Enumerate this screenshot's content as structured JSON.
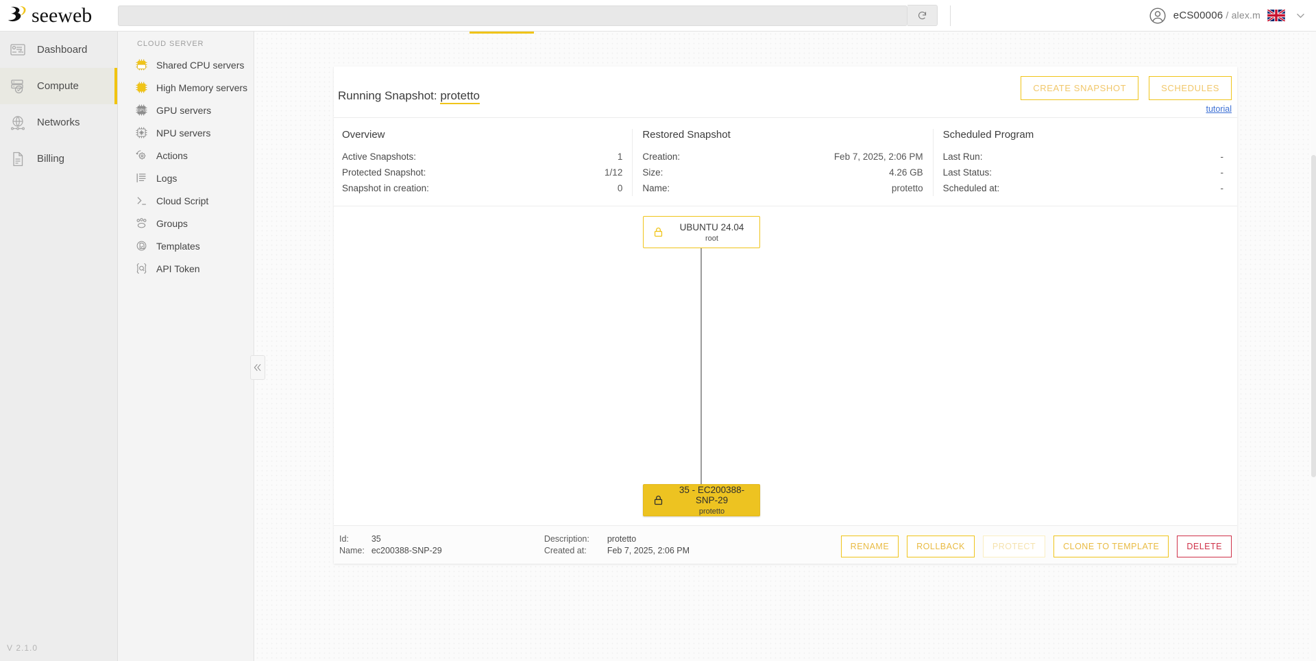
{
  "topbar": {
    "logo_text": "seeweb",
    "search": {
      "value": "",
      "placeholder": ""
    },
    "refresh_icon": "refresh-icon",
    "avatar_icon": "user-avatar-icon",
    "account": "eCS00006",
    "account_separator": " / ",
    "username": "alex.m",
    "flag_icon": "uk-flag-icon",
    "chevron_icon": "chevron-down-icon"
  },
  "sidebar": {
    "items": [
      {
        "label": "Dashboard",
        "icon": "dashboard-icon",
        "active": false
      },
      {
        "label": "Compute",
        "icon": "server-icon",
        "active": true
      },
      {
        "label": "Networks",
        "icon": "globe-network-icon",
        "active": false
      },
      {
        "label": "Billing",
        "icon": "document-icon",
        "active": false
      }
    ],
    "version": "V 2.1.0"
  },
  "subsidebar": {
    "title": "CLOUD SERVER",
    "items": [
      {
        "label": "Shared CPU servers",
        "icon": "cpu-chip-icon"
      },
      {
        "label": "High Memory servers",
        "icon": "memory-chip-icon"
      },
      {
        "label": "GPU servers",
        "icon": "gpu-chip-icon"
      },
      {
        "label": "NPU servers",
        "icon": "npu-chip-icon"
      },
      {
        "label": "Actions",
        "icon": "gear-actions-icon"
      },
      {
        "label": "Logs",
        "icon": "list-logs-icon"
      },
      {
        "label": "Cloud Script",
        "icon": "terminal-prompt-icon"
      },
      {
        "label": "Groups",
        "icon": "groups-people-icon"
      },
      {
        "label": "Templates",
        "icon": "templates-icon"
      },
      {
        "label": "API Token",
        "icon": "api-token-icon"
      }
    ],
    "collapse_icon": "double-chevron-left-icon"
  },
  "main": {
    "title_prefix": "Running Snapshot: ",
    "title_value": "protetto",
    "create_snapshot_label": "CREATE SNAPSHOT",
    "schedules_label": "SCHEDULES",
    "tutorial_label": "tutorial",
    "info": {
      "overview": {
        "heading": "Overview",
        "rows": [
          {
            "key": "Active Snapshots:",
            "value": "1"
          },
          {
            "key": "Protected Snapshot:",
            "value": "1/12"
          },
          {
            "key": "Snapshot in creation:",
            "value": "0"
          }
        ]
      },
      "restored": {
        "heading": "Restored Snapshot",
        "rows": [
          {
            "key": "Creation:",
            "value": "Feb 7, 2025, 2:06 PM"
          },
          {
            "key": "Size:",
            "value": "4.26 GB"
          },
          {
            "key": "Name:",
            "value": "protetto"
          }
        ]
      },
      "scheduled": {
        "heading": "Scheduled Program",
        "rows": [
          {
            "key": "Last Run:",
            "value": "-"
          },
          {
            "key": "Last Status:",
            "value": "-"
          },
          {
            "key": "Scheduled at:",
            "value": "-"
          }
        ]
      }
    },
    "tree": {
      "root_node": {
        "title": "UBUNTU 24.04",
        "subtitle": "root",
        "icon": "lock-icon"
      },
      "leaf_node": {
        "title": "35 - EC200388-SNP-29",
        "subtitle": "protetto",
        "icon": "lock-icon"
      }
    },
    "footer": {
      "col1": {
        "keys": [
          "Id:",
          "Name:"
        ],
        "values": [
          "35",
          "ec200388-SNP-29"
        ]
      },
      "col2": {
        "keys": [
          "Description:",
          "Created at:"
        ],
        "values": [
          "protetto",
          "Feb 7, 2025, 2:06 PM"
        ]
      },
      "buttons": [
        {
          "label": "RENAME",
          "state": "enabled"
        },
        {
          "label": "ROLLBACK",
          "state": "enabled"
        },
        {
          "label": "PROTECT",
          "state": "disabled"
        },
        {
          "label": "CLONE TO TEMPLATE",
          "state": "enabled"
        },
        {
          "label": "DELETE",
          "state": "danger"
        }
      ]
    }
  },
  "colors": {
    "accent_yellow": "#f0c419",
    "node_fill": "#edc321",
    "danger_red": "#cf3148",
    "link_blue": "#3b6fd4"
  }
}
